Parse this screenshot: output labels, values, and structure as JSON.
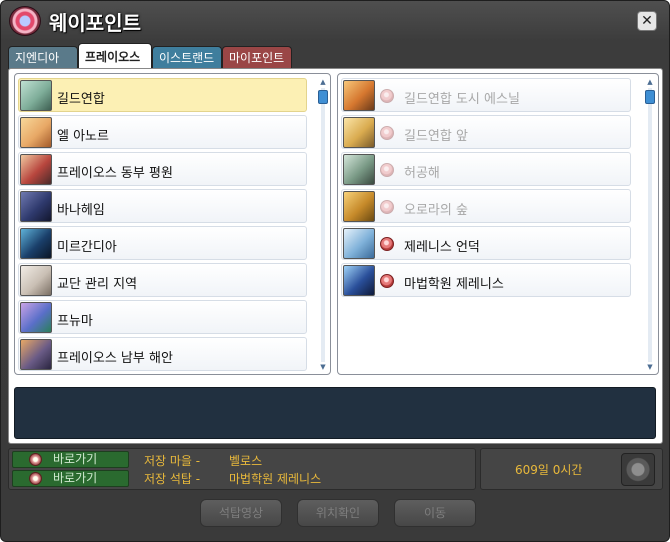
{
  "window": {
    "title": "웨이포인트",
    "close_label": "✕"
  },
  "tabs": [
    {
      "label": "지엔디아"
    },
    {
      "label": "프레이오스"
    },
    {
      "label": "이스트랜드"
    },
    {
      "label": "마이포인트"
    }
  ],
  "regions": [
    {
      "label": "길드연합",
      "thumb": "#7fae9a"
    },
    {
      "label": "엘 아노르",
      "thumb": "#e8a866"
    },
    {
      "label": "프레이오스 동부 평원",
      "thumb": "#b8463e"
    },
    {
      "label": "바나헤임",
      "thumb": "#2f3a6e"
    },
    {
      "label": "미르간디아",
      "thumb": "#1a3f6a"
    },
    {
      "label": "교단 관리 지역",
      "thumb": "#c9bfb4"
    },
    {
      "label": "프뉴마",
      "thumb": "#5a6fc9"
    },
    {
      "label": "프레이오스 남부 해안",
      "thumb": "#6a5b86"
    }
  ],
  "waypoints": [
    {
      "label": "길드연합 도시 에스닐",
      "thumb": "#d5772f"
    },
    {
      "label": "길드연합 앞",
      "thumb": "#d9ab4f"
    },
    {
      "label": "허공해",
      "thumb": "#7a9a86"
    },
    {
      "label": "오로라의 숲",
      "thumb": "#c68a2a"
    },
    {
      "label": "제레니스 언덕",
      "thumb": "#7fb1d9"
    },
    {
      "label": "마법학원 제레니스",
      "thumb": "#2a4f9a"
    }
  ],
  "shortcut": {
    "go_label": "바로가기",
    "saved_town_label": "저장 마을  -",
    "saved_town_value": "벨로스",
    "saved_stone_label": "저장 석탑  -",
    "saved_stone_value": "마법학원 제레니스"
  },
  "cooldown": {
    "time": "609일 0시간"
  },
  "actions": {
    "stone_video": "석탑영상",
    "check_location": "위치확인",
    "move": "이동"
  },
  "colors": {
    "selected_row": "#fcf0b4",
    "info_text": "#e9b93b",
    "go_button": "#2a6a2f",
    "description_bg": "#213040"
  }
}
